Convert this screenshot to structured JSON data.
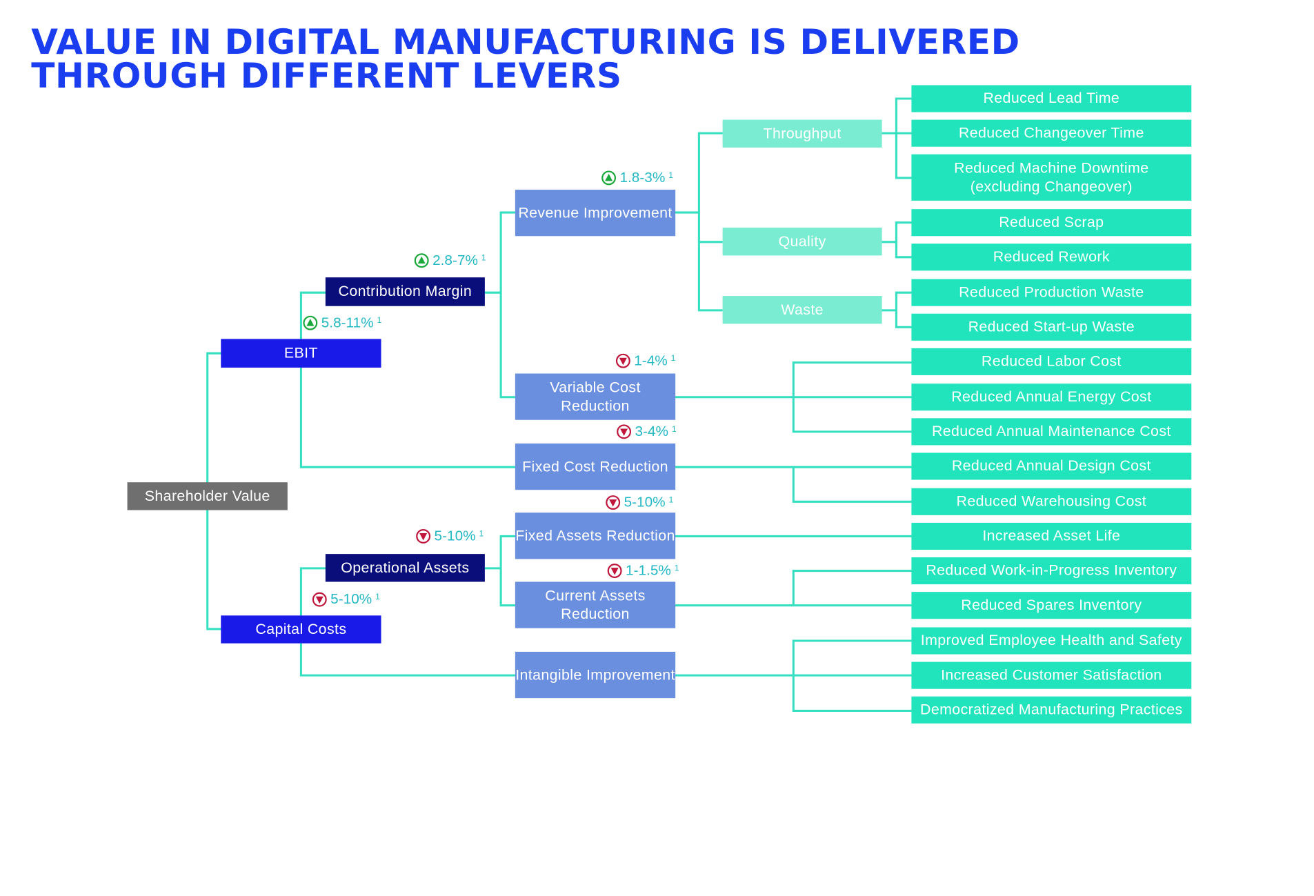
{
  "title": {
    "line1": "VALUE  IN DIGITAL MANUFACTURING IS DELIVERED",
    "line2": "THROUGH DIFFERENT LEVERS"
  },
  "colors": {
    "title": "#1a3df0",
    "connector": "#34e0c0",
    "up_arrow": "#1aa83a",
    "down_arrow": "#c0163c",
    "percent_text": "#22b8c4",
    "shareholder": "#6f6f6f",
    "level1": "#1a1ae8",
    "level2": "#0a0e7a",
    "level3": "#6b8fdf",
    "driver": "#7aecd2",
    "leaf": "#21e4bd"
  },
  "nodes": {
    "shareholder_value": "Shareholder Value",
    "ebit": "EBIT",
    "capital_costs": "Capital Costs",
    "contribution_margin": "Contribution Margin",
    "operational_assets": "Operational Assets",
    "revenue_improvement": "Revenue Improvement",
    "variable_cost_reduction": "Variable Cost Reduction",
    "fixed_cost_reduction": "Fixed Cost Reduction",
    "fixed_assets_reduction": "Fixed Assets Reduction",
    "current_assets_reduction": "Current Assets Reduction",
    "intangible_improvement": "Intangible Improvement",
    "throughput": "Throughput",
    "quality": "Quality",
    "waste": "Waste"
  },
  "percentages": {
    "ebit": {
      "value": "5.8-11%",
      "note": "1",
      "direction": "up"
    },
    "contribution_margin": {
      "value": "2.8-7%",
      "note": "1",
      "direction": "up"
    },
    "revenue_improvement": {
      "value": "1.8-3%",
      "note": "1",
      "direction": "up"
    },
    "variable_cost_reduction": {
      "value": "1-4%",
      "note": "1",
      "direction": "down"
    },
    "fixed_cost_reduction": {
      "value": "3-4%",
      "note": "1",
      "direction": "down"
    },
    "fixed_assets_reduction": {
      "value": "5-10%",
      "note": "1",
      "direction": "down"
    },
    "operational_assets": {
      "value": "5-10%",
      "note": "1",
      "direction": "down"
    },
    "current_assets_reduction": {
      "value": "1-1.5%",
      "note": "1",
      "direction": "down"
    },
    "capital_costs": {
      "value": "5-10%",
      "note": "1",
      "direction": "down"
    }
  },
  "leaves": [
    "Reduced Lead Time",
    "Reduced Changeover Time",
    "Reduced Machine Downtime (excluding Changeover)",
    "Reduced Scrap",
    "Reduced Rework",
    "Reduced Production Waste",
    "Reduced Start-up Waste",
    "Reduced Labor Cost",
    "Reduced Annual Energy Cost",
    "Reduced Annual Maintenance Cost",
    "Reduced Annual Design Cost",
    "Reduced Warehousing Cost",
    "Increased Asset Life",
    "Reduced Work-in-Progress Inventory",
    "Reduced Spares Inventory",
    "Improved Employee Health and Safety",
    "Increased Customer Satisfaction",
    "Democratized Manufacturing Practices"
  ]
}
